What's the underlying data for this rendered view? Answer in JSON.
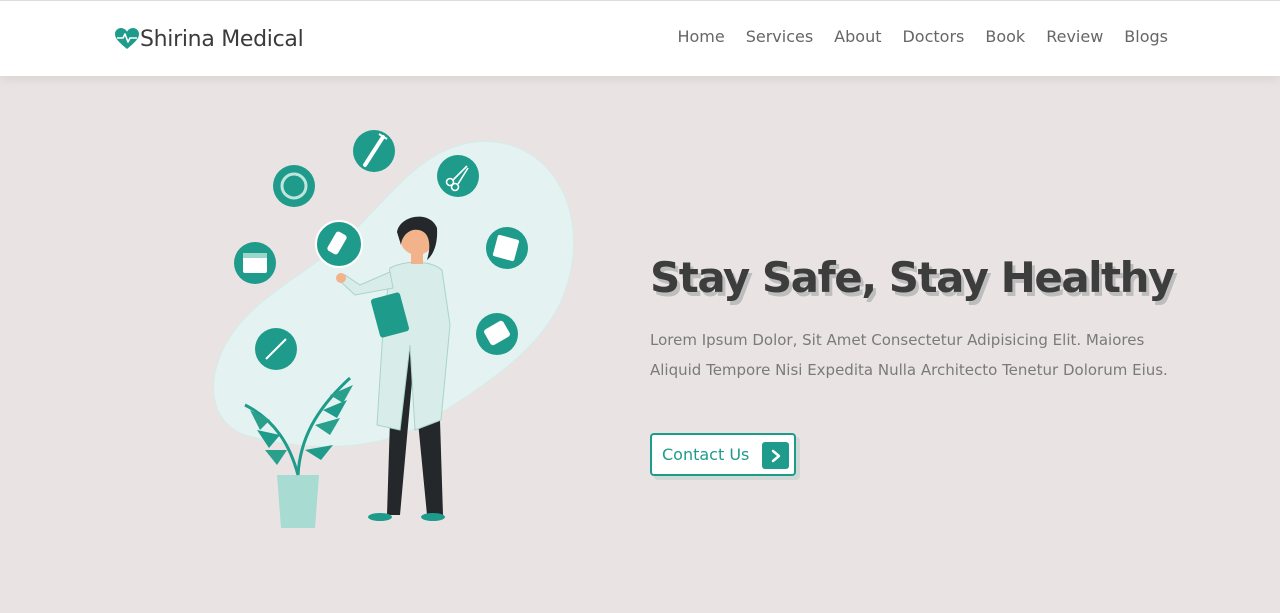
{
  "brand": {
    "name": "Shirina Medical",
    "accent": "#1e9b8a",
    "icon": "heart-pulse-icon"
  },
  "nav": {
    "items": [
      {
        "label": "Home"
      },
      {
        "label": "Services"
      },
      {
        "label": "About"
      },
      {
        "label": "Doctors"
      },
      {
        "label": "Book"
      },
      {
        "label": "Review"
      },
      {
        "label": "Blogs"
      }
    ]
  },
  "hero": {
    "title": "Stay Safe, Stay Healthy",
    "description": "Lorem Ipsum Dolor, Sit Amet Consectetur Adipisicing Elit. Maiores Aliquid Tempore Nisi Expedita Nulla Architecto Tenetur Dolorum Eius.",
    "cta_label": "Contact Us",
    "cta_icon": "chevron-right-icon",
    "illustration": "doctor-with-medical-icons-illustration"
  },
  "colors": {
    "background": "#e9e4e3",
    "header": "#ffffff",
    "text_dark": "#3d3d3d",
    "text_muted": "#7a7a7a"
  }
}
